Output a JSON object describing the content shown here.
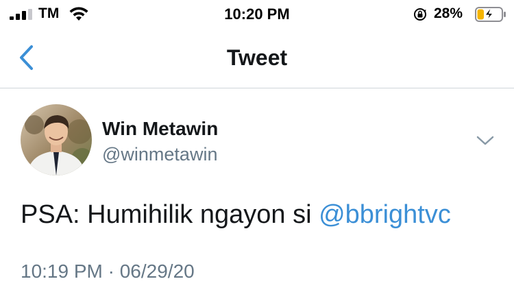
{
  "status_bar": {
    "carrier": "TM",
    "time": "10:20 PM",
    "battery_percent": "28%",
    "battery_level": 0.28,
    "charging": true,
    "icons": [
      "signal-bars-icon",
      "wifi-icon",
      "orientation-lock-icon",
      "battery-charging-icon"
    ]
  },
  "nav": {
    "title": "Tweet",
    "back_icon": "chevron-left-icon"
  },
  "tweet": {
    "author": {
      "display_name": "Win Metawin",
      "handle": "@winmetawin"
    },
    "text_prefix": "PSA: Humihilik ngayon si ",
    "mention": "@bbrightvc",
    "timestamp": "10:19 PM · 06/29/20",
    "menu_icon": "chevron-down-icon"
  },
  "colors": {
    "accent": "#3b8fd6",
    "text_primary": "#14171a",
    "text_secondary": "#657786",
    "divider": "#cfd5da",
    "battery_charge": "#f5b400"
  }
}
